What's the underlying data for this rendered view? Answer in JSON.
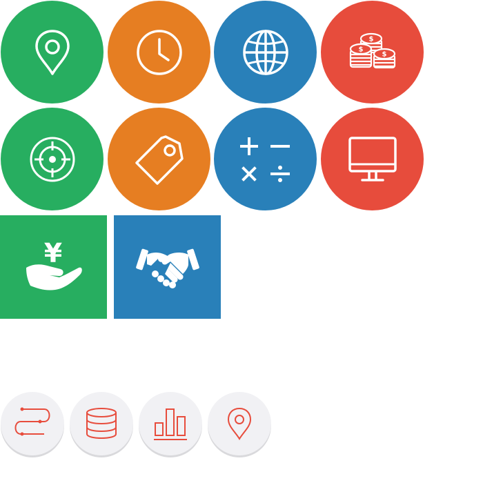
{
  "colors": {
    "green": "#27ae60",
    "orange": "#e67e22",
    "blue": "#2980b9",
    "red": "#e74c3c",
    "white": "#ffffff",
    "small_bg": "#f1f1f4",
    "small_line": "#e74c3c"
  },
  "icons": [
    {
      "name": "location-pin-icon",
      "shape": "circle",
      "color": "green"
    },
    {
      "name": "clock-icon",
      "shape": "circle",
      "color": "orange"
    },
    {
      "name": "globe-icon",
      "shape": "circle",
      "color": "blue"
    },
    {
      "name": "coins-icon",
      "shape": "circle",
      "color": "red",
      "glyph": "$"
    },
    {
      "name": "target-icon",
      "shape": "circle",
      "color": "green"
    },
    {
      "name": "price-tag-icon",
      "shape": "circle",
      "color": "orange"
    },
    {
      "name": "calculator-operators-icon",
      "shape": "circle",
      "color": "blue"
    },
    {
      "name": "monitor-icon",
      "shape": "circle",
      "color": "red"
    },
    {
      "name": "yen-hand-icon",
      "shape": "square",
      "color": "green",
      "glyph": "¥"
    },
    {
      "name": "handshake-icon",
      "shape": "square",
      "color": "blue"
    },
    {
      "name": "route-icon",
      "shape": "small-circle",
      "color": "small_line"
    },
    {
      "name": "database-icon",
      "shape": "small-circle",
      "color": "small_line"
    },
    {
      "name": "bar-chart-icon",
      "shape": "small-circle",
      "color": "small_line"
    },
    {
      "name": "location-pin-outline-icon",
      "shape": "small-circle",
      "color": "small_line"
    }
  ]
}
